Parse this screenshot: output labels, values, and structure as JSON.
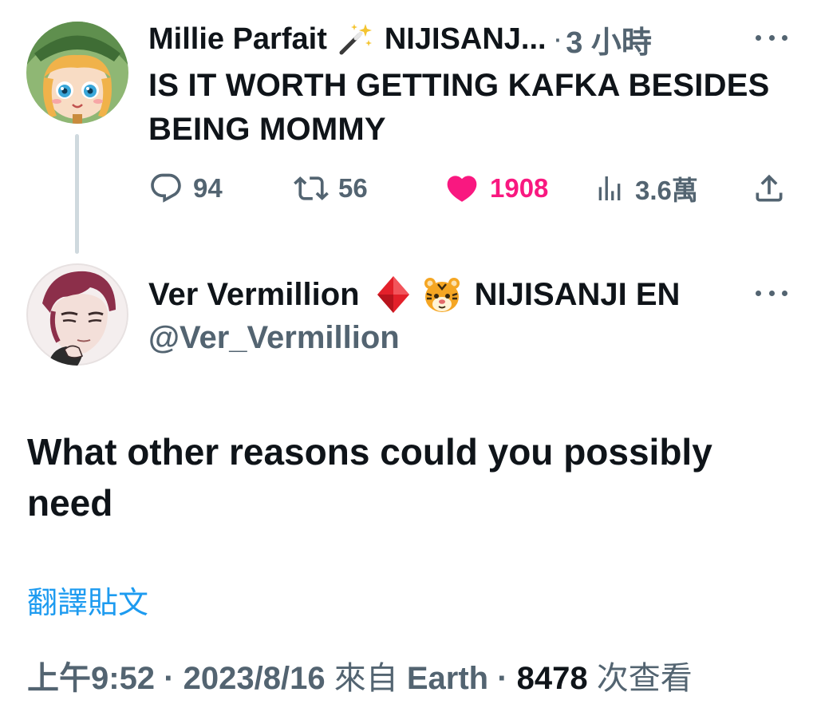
{
  "parent_tweet": {
    "author_name": "Millie Parfait",
    "author_emoji": "wand-sparkles-icon",
    "affiliation": "NIJISANJ...",
    "separator": "·",
    "time": "3 小時",
    "text": "IS IT WORTH GETTING KAFKA BESIDES BEING MOMMY",
    "stats": {
      "replies": "94",
      "retweets": "56",
      "likes": "1908",
      "views": "3.6萬"
    },
    "like_color": "#f91880"
  },
  "reply_tweet": {
    "author_name": "Ver Vermillion",
    "emojis": [
      "red-diamond-icon",
      "tiger-face-icon"
    ],
    "affiliation": "NIJISANJI EN",
    "handle": "@Ver_Vermillion",
    "text": "What other reasons could you possibly need",
    "translate_label": "翻譯貼文",
    "meta": {
      "time": "上午9:52",
      "sep1": "·",
      "date": "2023/8/16",
      "source_prefix": "來自",
      "source": "Earth",
      "sep2": "·",
      "views": "8478",
      "views_suffix": "次查看"
    }
  },
  "colors": {
    "text": "#0f1419",
    "muted": "#536471",
    "link": "#1d9bf0",
    "thread_line": "#cfd9de"
  }
}
